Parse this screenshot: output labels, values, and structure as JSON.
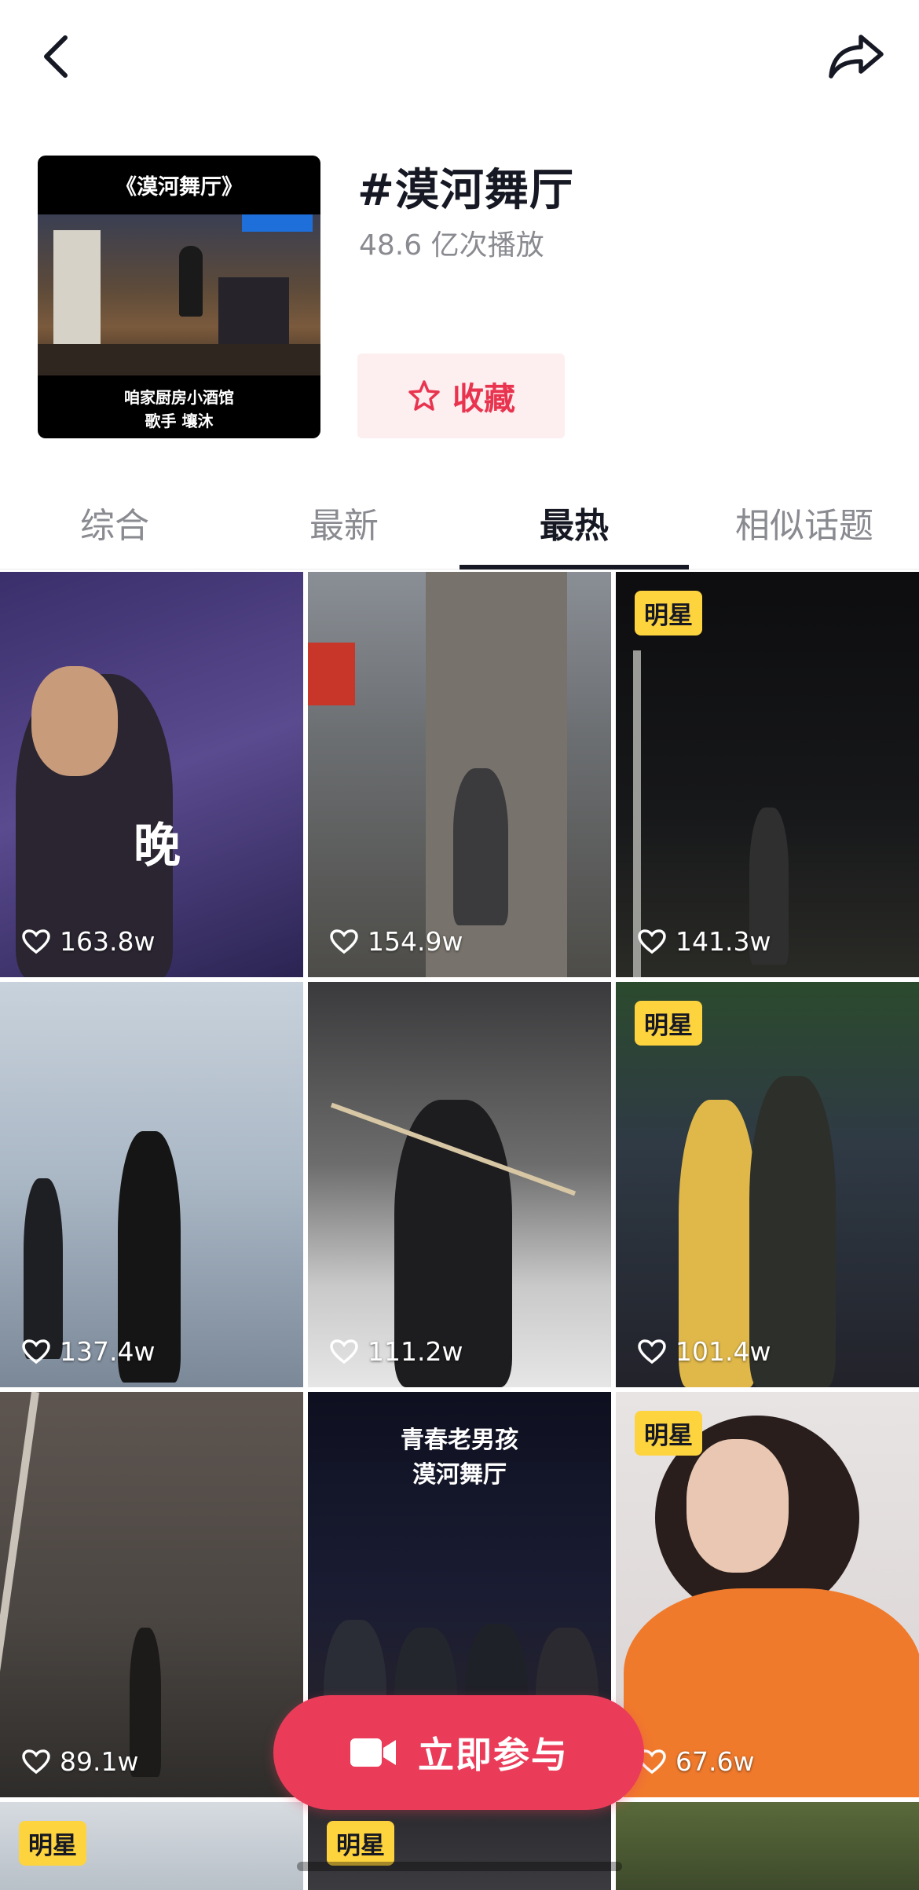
{
  "topbar": {
    "back_icon": "chevron-left-icon",
    "share_icon": "share-arrow-icon"
  },
  "header": {
    "cover_title": "《漠河舞厅》",
    "cover_caption_line1": "咱家厨房小酒馆",
    "cover_caption_line2": "歌手 壤沐",
    "topic_title": "#漠河舞厅",
    "play_count": "48.6 亿次播放",
    "favorite_label": "收藏",
    "favorite_icon": "star-outline-icon"
  },
  "tabs": [
    {
      "label": "综合",
      "active": false
    },
    {
      "label": "最新",
      "active": false
    },
    {
      "label": "最热",
      "active": true
    },
    {
      "label": "相似话题",
      "active": false
    }
  ],
  "videos": [
    {
      "likes": "163.8w",
      "badge": "",
      "overlay": "晚"
    },
    {
      "likes": "154.9w",
      "badge": "",
      "overlay": ""
    },
    {
      "likes": "141.3w",
      "badge": "明星",
      "overlay": ""
    },
    {
      "likes": "137.4w",
      "badge": "",
      "overlay": ""
    },
    {
      "likes": "111.2w",
      "badge": "",
      "overlay": ""
    },
    {
      "likes": "101.4w",
      "badge": "明星",
      "overlay": ""
    },
    {
      "likes": "89.1w",
      "badge": "",
      "overlay": ""
    },
    {
      "likes": "",
      "badge": "",
      "overlay_line1": "青春老男孩",
      "overlay_line2": "漠河舞厅"
    },
    {
      "likes": "67.6w",
      "badge": "明星",
      "overlay": ""
    },
    {
      "likes": "",
      "badge": "明星",
      "overlay": ""
    },
    {
      "likes": "",
      "badge": "明星",
      "overlay": ""
    },
    {
      "likes": "",
      "badge": "",
      "overlay": ""
    }
  ],
  "join_button": {
    "label": "立即参与",
    "icon": "video-camera-icon"
  },
  "colors": {
    "accent": "#ea3c59",
    "badge": "#fdd33e",
    "favorite_bg": "#fdeef0"
  }
}
